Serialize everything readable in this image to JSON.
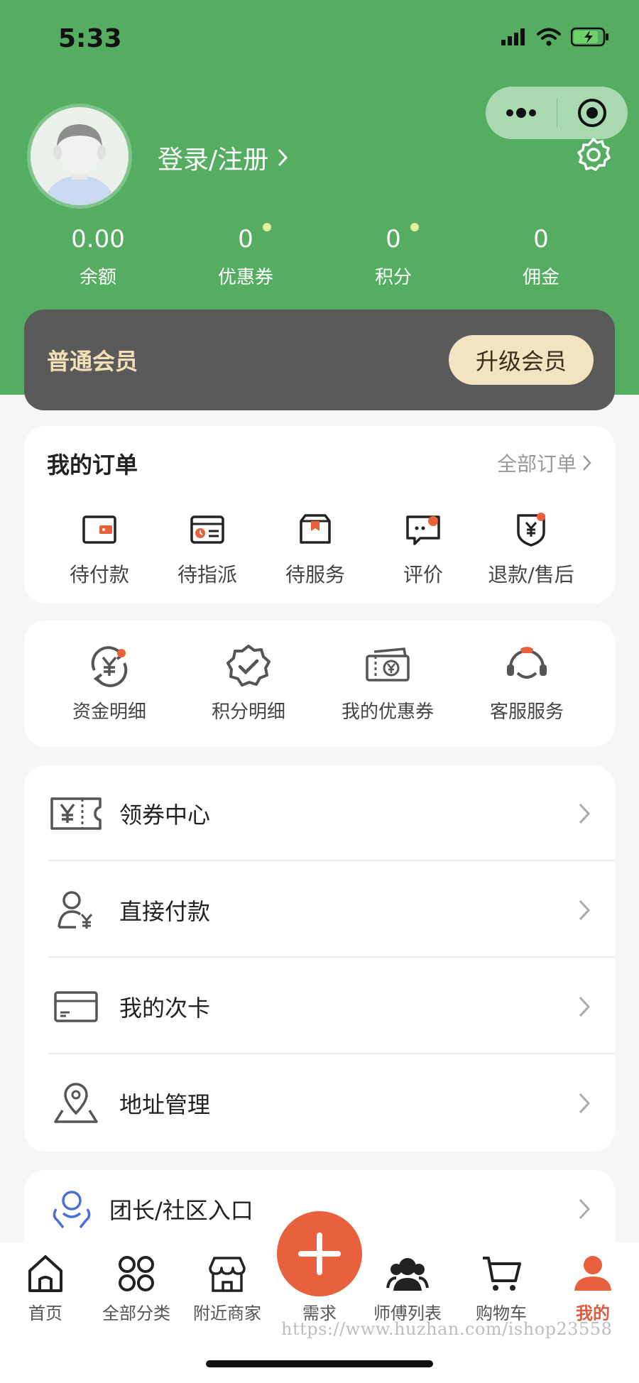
{
  "status_bar": {
    "time": "5:33"
  },
  "profile": {
    "login_label": "登录/注册"
  },
  "stats": [
    {
      "value": "0.00",
      "label": "余额",
      "has_dot": false
    },
    {
      "value": "0",
      "label": "优惠券",
      "has_dot": true
    },
    {
      "value": "0",
      "label": "积分",
      "has_dot": true
    },
    {
      "value": "0",
      "label": "佣金",
      "has_dot": false
    }
  ],
  "member": {
    "title": "普通会员",
    "upgrade_label": "升级会员"
  },
  "orders": {
    "title": "我的订单",
    "all_label": "全部订单",
    "items": [
      {
        "label": "待付款",
        "icon": "wallet-icon"
      },
      {
        "label": "待指派",
        "icon": "card-clock-icon"
      },
      {
        "label": "待服务",
        "icon": "box-icon"
      },
      {
        "label": "评价",
        "icon": "comment-icon"
      },
      {
        "label": "退款/售后",
        "icon": "refund-shield-icon"
      }
    ]
  },
  "tools": [
    {
      "label": "资金明细",
      "icon": "yuan-cycle-icon"
    },
    {
      "label": "积分明细",
      "icon": "badge-check-icon"
    },
    {
      "label": "我的优惠券",
      "icon": "coupon-ticket-icon"
    },
    {
      "label": "客服服务",
      "icon": "headset-icon"
    }
  ],
  "menu": [
    {
      "label": "领券中心",
      "icon": "coupon-center-icon"
    },
    {
      "label": "直接付款",
      "icon": "user-pay-icon"
    },
    {
      "label": "我的次卡",
      "icon": "card-icon"
    },
    {
      "label": "地址管理",
      "icon": "location-map-icon"
    }
  ],
  "team": {
    "label": "团长/社区入口",
    "icon": "community-icon"
  },
  "tabbar": [
    {
      "label": "首页",
      "icon": "home-icon"
    },
    {
      "label": "全部分类",
      "icon": "grid-circles-icon"
    },
    {
      "label": "附近商家",
      "icon": "store-icon"
    },
    {
      "label": "需求",
      "icon": "plus-icon"
    },
    {
      "label": "师傅列表",
      "icon": "workers-icon"
    },
    {
      "label": "购物车",
      "icon": "cart-icon"
    },
    {
      "label": "我的",
      "icon": "profile-icon"
    }
  ],
  "watermark": "https://www.huzhan.com/ishop23558",
  "colors": {
    "primary_green": "#55ad61",
    "accent_orange": "#e8603c",
    "member_gold": "#f4e3c1"
  }
}
